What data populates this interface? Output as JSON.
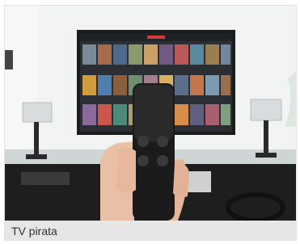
{
  "card": {
    "caption": "TV pirata"
  },
  "image": {
    "subject": "tv-remote-scene-icon"
  }
}
